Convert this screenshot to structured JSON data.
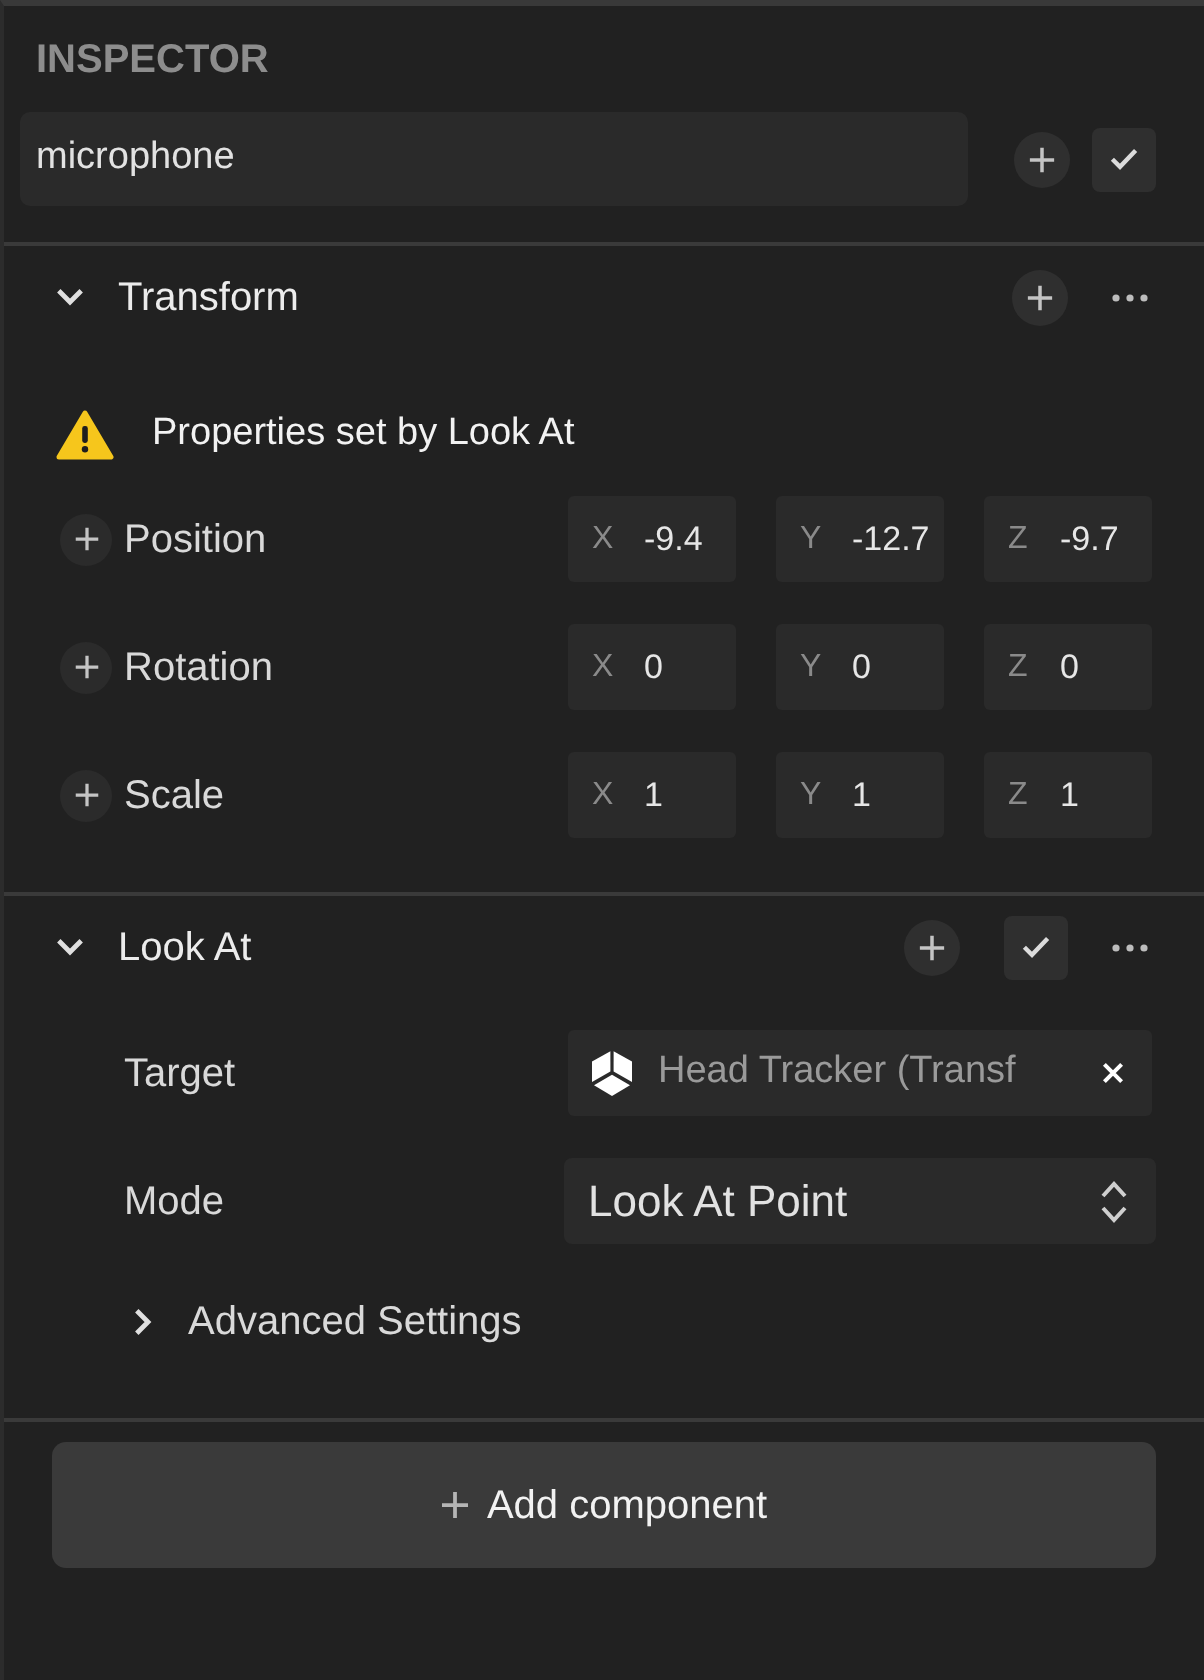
{
  "panel": {
    "title": "INSPECTOR"
  },
  "object": {
    "name": "microphone",
    "enabled": true
  },
  "components": [
    {
      "kind": "transform",
      "title": "Transform",
      "expanded": true,
      "warning": "Properties set by Look At",
      "properties": [
        {
          "kind": "vector",
          "label": "Position",
          "fields": [
            {
              "axis": "X",
              "value": "-9.4"
            },
            {
              "axis": "Y",
              "value": "-12.7"
            },
            {
              "axis": "Z",
              "value": "-9.7"
            }
          ]
        },
        {
          "kind": "vector",
          "label": "Rotation",
          "fields": [
            {
              "axis": "X",
              "value": "0"
            },
            {
              "axis": "Y",
              "value": "0"
            },
            {
              "axis": "Z",
              "value": "0"
            }
          ]
        },
        {
          "kind": "vector",
          "label": "Scale",
          "fields": [
            {
              "axis": "X",
              "value": "1"
            },
            {
              "axis": "Y",
              "value": "1"
            },
            {
              "axis": "Z",
              "value": "1"
            }
          ]
        }
      ]
    },
    {
      "kind": "look_at",
      "title": "Look At",
      "expanded": true,
      "enabled": true,
      "properties": [
        {
          "kind": "object",
          "label": "Target",
          "value": "Head Tracker (Transf"
        },
        {
          "kind": "select",
          "label": "Mode",
          "value": "Look At Point"
        },
        {
          "kind": "group",
          "label": "Advanced Settings",
          "expanded": false
        }
      ]
    }
  ],
  "add_button": {
    "label": "Add component"
  }
}
